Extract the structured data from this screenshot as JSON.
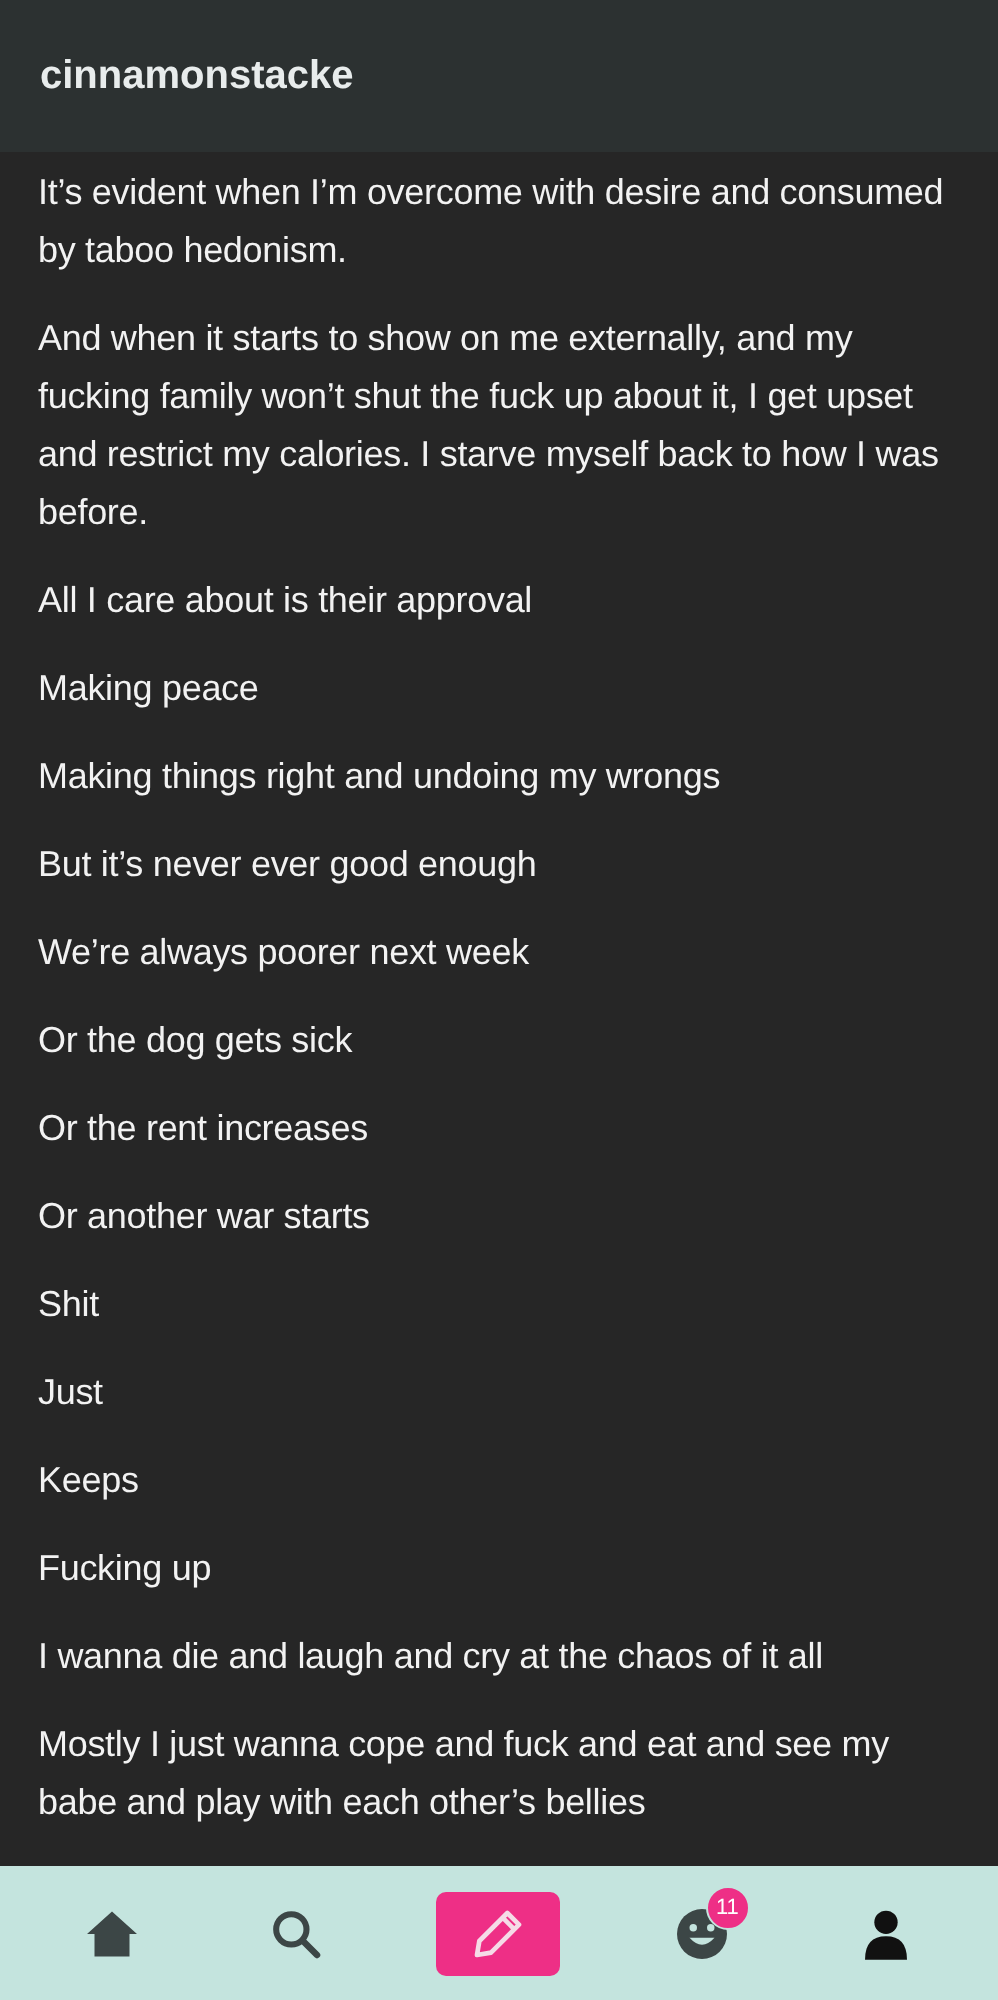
{
  "header": {
    "username": "cinnamonstacke"
  },
  "paragraphs": [
    "It’s evident when I’m overcome with desire and consumed by taboo hedonism.",
    "And when it starts to show on me externally, and my fucking family won’t shut the fuck up about it, I get upset and restrict my calories. I starve myself back to how I was before.",
    "All I care about is their approval",
    "Making peace",
    "Making things right and undoing my wrongs",
    "But it’s never ever good enough",
    "We’re always poorer next week",
    "Or the dog gets sick",
    "Or the rent increases",
    "Or another war starts",
    "Shit",
    "Just",
    "Keeps",
    "Fucking up",
    "I wanna die and laugh and cry at the chaos of it all",
    "Mostly I just wanna cope and fuck and eat and see my babe and play with each other’s bellies"
  ],
  "nav": [
    {
      "kind": "home"
    },
    {
      "kind": "search"
    },
    {
      "kind": "compose"
    },
    {
      "kind": "activity",
      "badge": "11"
    },
    {
      "kind": "account"
    }
  ]
}
